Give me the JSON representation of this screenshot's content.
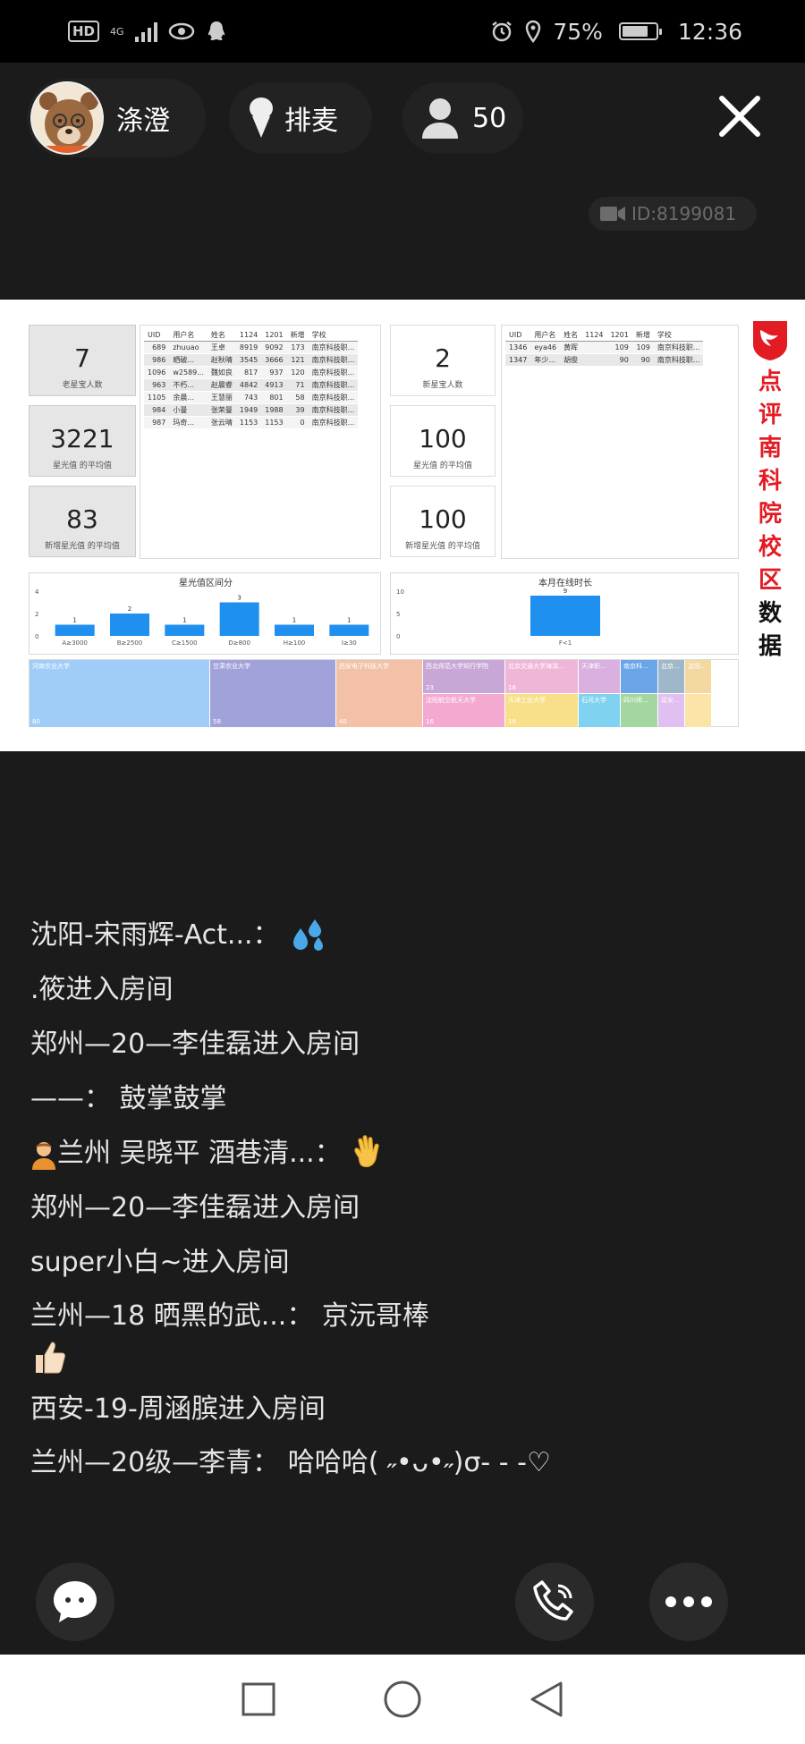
{
  "status_bar": {
    "battery": "75%",
    "time": "12:36",
    "network": "4G"
  },
  "header": {
    "host_name": "涤澄",
    "mic_label": "排麦",
    "viewer_count": "50"
  },
  "room_id": "ID:8199081",
  "slide": {
    "left_kpis": [
      {
        "value": "7",
        "caption": "老星宝人数"
      },
      {
        "value": "3221",
        "caption": "星光值 的平均值"
      },
      {
        "value": "83",
        "caption": "新增星光值 的平均值"
      }
    ],
    "left_table": {
      "headers": [
        "UID",
        "用户名",
        "姓名",
        "1124",
        "1201",
        "新增",
        "学校"
      ],
      "rows": [
        [
          "689",
          "zhuuao",
          "王卓",
          "8919",
          "9092",
          "173",
          "南京科技职..."
        ],
        [
          "986",
          "晒破...",
          "赵秋晴",
          "3545",
          "3666",
          "121",
          "南京科技职..."
        ],
        [
          "1096",
          "w2589...",
          "魏如良",
          "817",
          "937",
          "120",
          "南京科技职..."
        ],
        [
          "963",
          "不朽...",
          "赵晨睿",
          "4842",
          "4913",
          "71",
          "南京科技职..."
        ],
        [
          "1105",
          "余晨...",
          "王慧丽",
          "743",
          "801",
          "58",
          "南京科技职..."
        ],
        [
          "984",
          "小曼",
          "张荣曼",
          "1949",
          "1988",
          "39",
          "南京科技职..."
        ],
        [
          "987",
          "玛奇...",
          "张云晴",
          "1153",
          "1153",
          "0",
          "南京科技职..."
        ]
      ]
    },
    "right_kpis": [
      {
        "value": "2",
        "caption": "新星宝人数"
      },
      {
        "value": "100",
        "caption": "星光值 的平均值"
      },
      {
        "value": "100",
        "caption": "新增星光值 的平均值"
      }
    ],
    "right_table": {
      "headers": [
        "UID",
        "用户名",
        "姓名",
        "1124",
        "1201",
        "新增",
        "学校"
      ],
      "rows": [
        [
          "1346",
          "eya46",
          "黄晖",
          "",
          "109",
          "109",
          "南京科技职..."
        ],
        [
          "1347",
          "年少...",
          "胡俊",
          "",
          "90",
          "90",
          "南京科技职..."
        ]
      ]
    },
    "logo_text": [
      "点",
      "评",
      "南",
      "科",
      "院",
      "校",
      "区",
      "数",
      "据"
    ],
    "treemap": [
      {
        "label": "河南农业大学",
        "value": "80",
        "color": "#9fcdf8"
      },
      {
        "label": "甘肃农业大学",
        "value": "58",
        "color": "#a1a2d9"
      },
      {
        "label": "西安电子科技大学",
        "value": "40",
        "color": "#f2c1a8"
      },
      {
        "label": "西北师范大学知行学院",
        "value": "23",
        "color": "#c8a6d6"
      },
      {
        "label": "北京交通大学海滨...",
        "value": "18",
        "color": "#f0b6d8"
      },
      {
        "label": "天津职...",
        "value": "",
        "color": "#d9b0e0"
      },
      {
        "label": "南京科...",
        "value": "",
        "color": "#6aa5e8"
      },
      {
        "label": "北京...",
        "value": "",
        "color": "#9fb8c9"
      },
      {
        "label": "沈阳...",
        "value": "",
        "color": "#f3d8a0"
      },
      {
        "label": "沈阳航空航天大学",
        "value": "16",
        "color": "#f4a9d0"
      },
      {
        "label": "天津工业大学",
        "value": "16",
        "color": "#f8e08a"
      },
      {
        "label": "石河大学",
        "value": "",
        "color": "#7fd3f0"
      },
      {
        "label": "四川师...",
        "value": "",
        "color": "#a3d6a0"
      },
      {
        "label": "延安...",
        "value": "",
        "color": "#e0c0f0"
      },
      {
        "label": "",
        "value": "",
        "color": "#fce3a8"
      }
    ]
  },
  "chart_data": [
    {
      "type": "bar",
      "title": "星光值区间分",
      "categories": [
        "A≥3000",
        "B≥2500",
        "C≥1500",
        "D≥800",
        "H≥100",
        "I≥30"
      ],
      "values": [
        1,
        2,
        1,
        3,
        1,
        1
      ],
      "ylim": [
        0,
        4
      ],
      "yticks": [
        0,
        2,
        4
      ],
      "color": "#1f8ff0"
    },
    {
      "type": "bar",
      "title": "本月在线时长",
      "categories": [
        "F<1"
      ],
      "values": [
        9
      ],
      "ylim": [
        0,
        10
      ],
      "yticks": [
        0,
        5,
        10
      ],
      "color": "#1f8ff0"
    }
  ],
  "chat": [
    {
      "text": "沈阳-宋雨辉-Act...：",
      "emoji": "sweat"
    },
    {
      "text": ".筱进入房间"
    },
    {
      "text": "郑州—20—李佳磊进入房间"
    },
    {
      "text": "——：  鼓掌鼓掌"
    },
    {
      "text": "兰州 吴晓平 酒巷清...：",
      "emoji": "wave",
      "prefix_emoji": "person"
    },
    {
      "text": "郑州—20—李佳磊进入房间"
    },
    {
      "text": "super小白~进入房间"
    },
    {
      "text": "兰州—18 晒黑的武...：  京沅哥棒",
      "emoji": "thumb"
    },
    {
      "text": "西安-19-周涵膑进入房间"
    },
    {
      "text": "兰州—20级—李青：  哈哈哈( ˶•ᴗ•˶)σ- - -♡"
    }
  ]
}
